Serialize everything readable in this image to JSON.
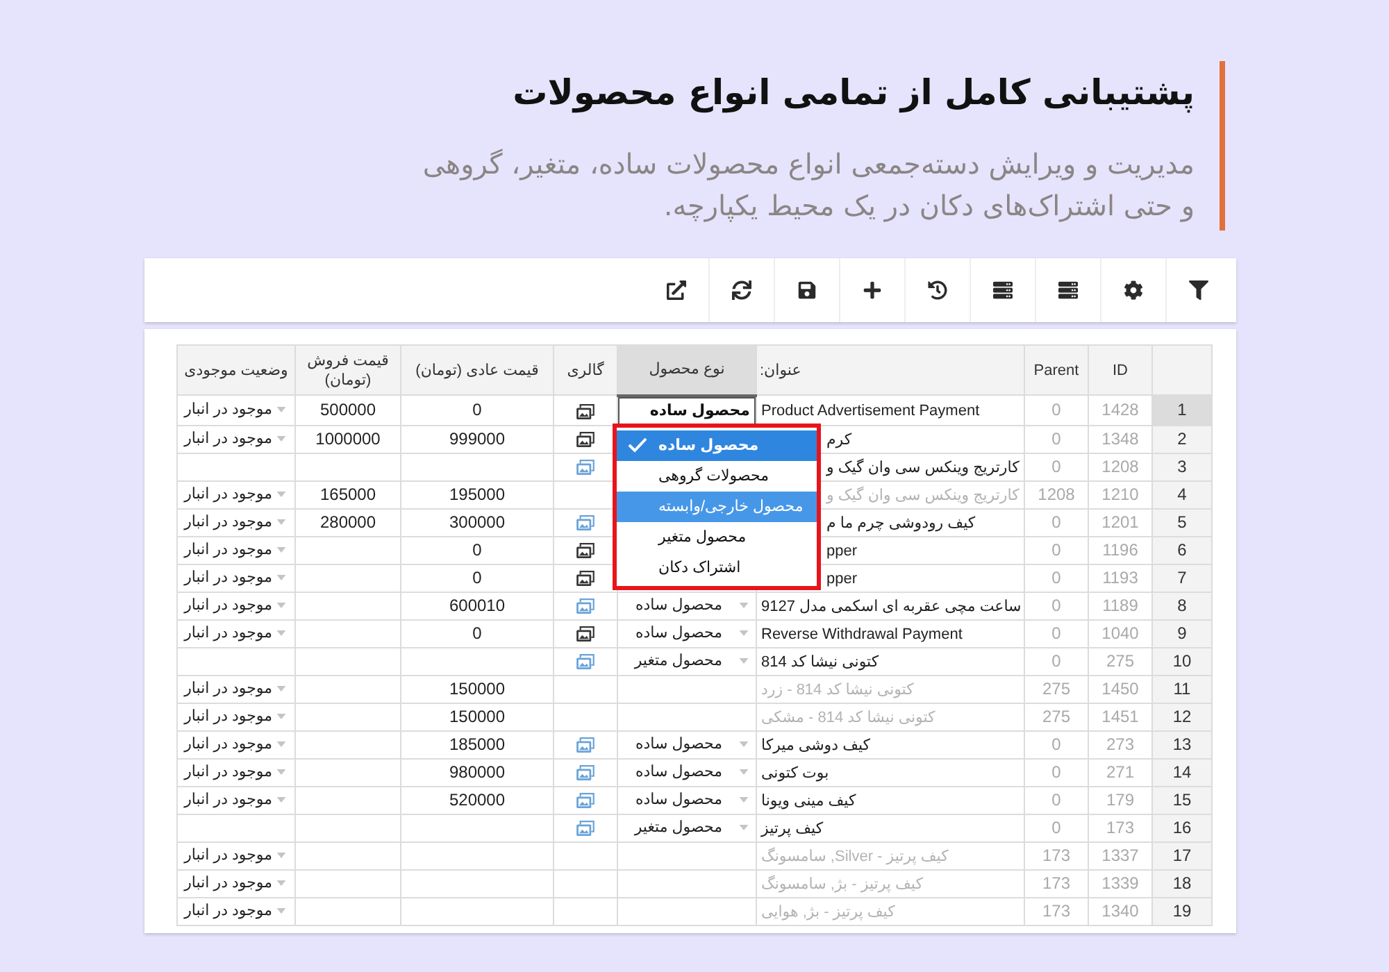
{
  "header": {
    "title": "پشتیبانی کامل از تمامی انواع محصولات",
    "subtitle": "مدیریت و ویرایش دسته‌جمعی انواع محصولات ساده، متغیر، گروهی\nو حتی اشتراک‌های دکان در یک محیط یکپارچه."
  },
  "table": {
    "columns": [
      {
        "label": "ID",
        "selected": false
      },
      {
        "label": "Parent",
        "selected": false
      },
      {
        "label": "عنوان:",
        "selected": false
      },
      {
        "label": "نوع محصول",
        "selected": true
      },
      {
        "label": "گالری",
        "selected": false
      },
      {
        "label": "قیمت عادی (تومان)",
        "selected": false
      },
      {
        "label": "قیمت فروش (تومان)",
        "selected": false
      },
      {
        "label": "وضعیت موجودی",
        "selected": false
      }
    ],
    "rows": [
      {
        "number": "1",
        "id": "1428",
        "parent": "0",
        "title": "Product Advertisement Payment",
        "dimmed": false,
        "type": "محصول ساده",
        "gallery": {
          "empty": false
        },
        "regular_price": "0",
        "sale_price": "500000",
        "stock": "موجود در انبار",
        "selected": true
      },
      {
        "number": "2",
        "id": "1348",
        "parent": "0",
        "title": "کرم",
        "dimmed": false,
        "gallery": {
          "empty": false
        },
        "regular_price": "999000",
        "sale_price": "1000000",
        "stock": "موجود در انبار",
        "selected": false
      },
      {
        "number": "3",
        "id": "1208",
        "parent": "0",
        "title": "کارتریج وینکس سی وان گیک و",
        "dimmed": false,
        "gallery": {
          "empty": true
        },
        "selected": false
      },
      {
        "number": "4",
        "id": "1210",
        "parent": "1208",
        "title": "کارتریج وینکس سی وان گیک و",
        "dimmed": true,
        "regular_price": "195000",
        "sale_price": "165000",
        "stock": "موجود در انبار",
        "selected": false
      },
      {
        "number": "5",
        "id": "1201",
        "parent": "0",
        "title": "کیف رودوشی چرم ما م",
        "dimmed": false,
        "gallery": {
          "empty": true
        },
        "regular_price": "300000",
        "sale_price": "280000",
        "stock": "موجود در انبار",
        "selected": false
      },
      {
        "number": "6",
        "id": "1196",
        "parent": "0",
        "title": "pper",
        "dimmed": false,
        "gallery": {
          "empty": false
        },
        "regular_price": "0",
        "stock": "موجود در انبار",
        "selected": false
      },
      {
        "number": "7",
        "id": "1193",
        "parent": "0",
        "title": "pper",
        "dimmed": false,
        "gallery": {
          "empty": false
        },
        "regular_price": "0",
        "stock": "موجود در انبار",
        "selected": false
      },
      {
        "number": "8",
        "id": "1189",
        "parent": "0",
        "title": "ساعت مچی عقربه ای اسکمی مدل 9127",
        "dimmed": false,
        "type": "محصول ساده",
        "gallery": {
          "empty": true
        },
        "regular_price": "600010",
        "stock": "موجود در انبار",
        "selected": false
      },
      {
        "number": "9",
        "id": "1040",
        "parent": "0",
        "title": "Reverse Withdrawal Payment",
        "dimmed": false,
        "type": "محصول ساده",
        "gallery": {
          "empty": false
        },
        "regular_price": "0",
        "stock": "موجود در انبار",
        "selected": false
      },
      {
        "number": "10",
        "id": "275",
        "parent": "0",
        "title": "کتونی نیشا کد 814",
        "dimmed": false,
        "type": "محصول متغیر",
        "gallery": {
          "empty": true
        },
        "selected": false
      },
      {
        "number": "11",
        "id": "1450",
        "parent": "275",
        "title": "کتونی نیشا کد 814 - زرد",
        "dimmed": true,
        "regular_price": "150000",
        "stock": "موجود در انبار",
        "selected": false
      },
      {
        "number": "12",
        "id": "1451",
        "parent": "275",
        "title": "کتونی نیشا کد 814 - مشکی",
        "dimmed": true,
        "regular_price": "150000",
        "stock": "موجود در انبار",
        "selected": false
      },
      {
        "number": "13",
        "id": "273",
        "parent": "0",
        "title": "کیف دوشی میرکا",
        "dimmed": false,
        "type": "محصول ساده",
        "gallery": {
          "empty": true
        },
        "regular_price": "185000",
        "stock": "موجود در انبار",
        "selected": false
      },
      {
        "number": "14",
        "id": "271",
        "parent": "0",
        "title": "بوت کتونی",
        "dimmed": false,
        "type": "محصول ساده",
        "gallery": {
          "empty": true
        },
        "regular_price": "980000",
        "stock": "موجود در انبار",
        "selected": false
      },
      {
        "number": "15",
        "id": "179",
        "parent": "0",
        "title": "کیف مینی ویونا",
        "dimmed": false,
        "type": "محصول ساده",
        "gallery": {
          "empty": true
        },
        "regular_price": "520000",
        "stock": "موجود در انبار",
        "selected": false
      },
      {
        "number": "16",
        "id": "173",
        "parent": "0",
        "title": "کیف پرتیز",
        "dimmed": false,
        "type": "محصول متغیر",
        "gallery": {
          "empty": true
        },
        "selected": false
      },
      {
        "number": "17",
        "id": "1337",
        "parent": "173",
        "title": "کیف پرتیز - Silver, سامسونگ",
        "dimmed": true,
        "stock": "موجود در انبار",
        "selected": false
      },
      {
        "number": "18",
        "id": "1339",
        "parent": "173",
        "title": "کیف پرتیز - بژ, سامسونگ",
        "dimmed": true,
        "stock": "موجود در انبار",
        "selected": false
      },
      {
        "number": "19",
        "id": "1340",
        "parent": "173",
        "title": "کیف پرتیز - بژ, هوایی",
        "dimmed": true,
        "stock": "موجود در انبار",
        "selected": false
      }
    ],
    "type_dropdown": {
      "expanded": true,
      "options": [
        {
          "label": "محصول ساده",
          "selected": true,
          "highlighted": false
        },
        {
          "label": "محصولات گروهی",
          "selected": false,
          "highlighted": false
        },
        {
          "label": "محصول خارجی/وابسته",
          "selected": false,
          "highlighted": true
        },
        {
          "label": "محصول متغیر",
          "selected": false,
          "highlighted": false
        },
        {
          "label": "اشتراک دکان",
          "selected": false,
          "highlighted": false
        }
      ]
    }
  }
}
